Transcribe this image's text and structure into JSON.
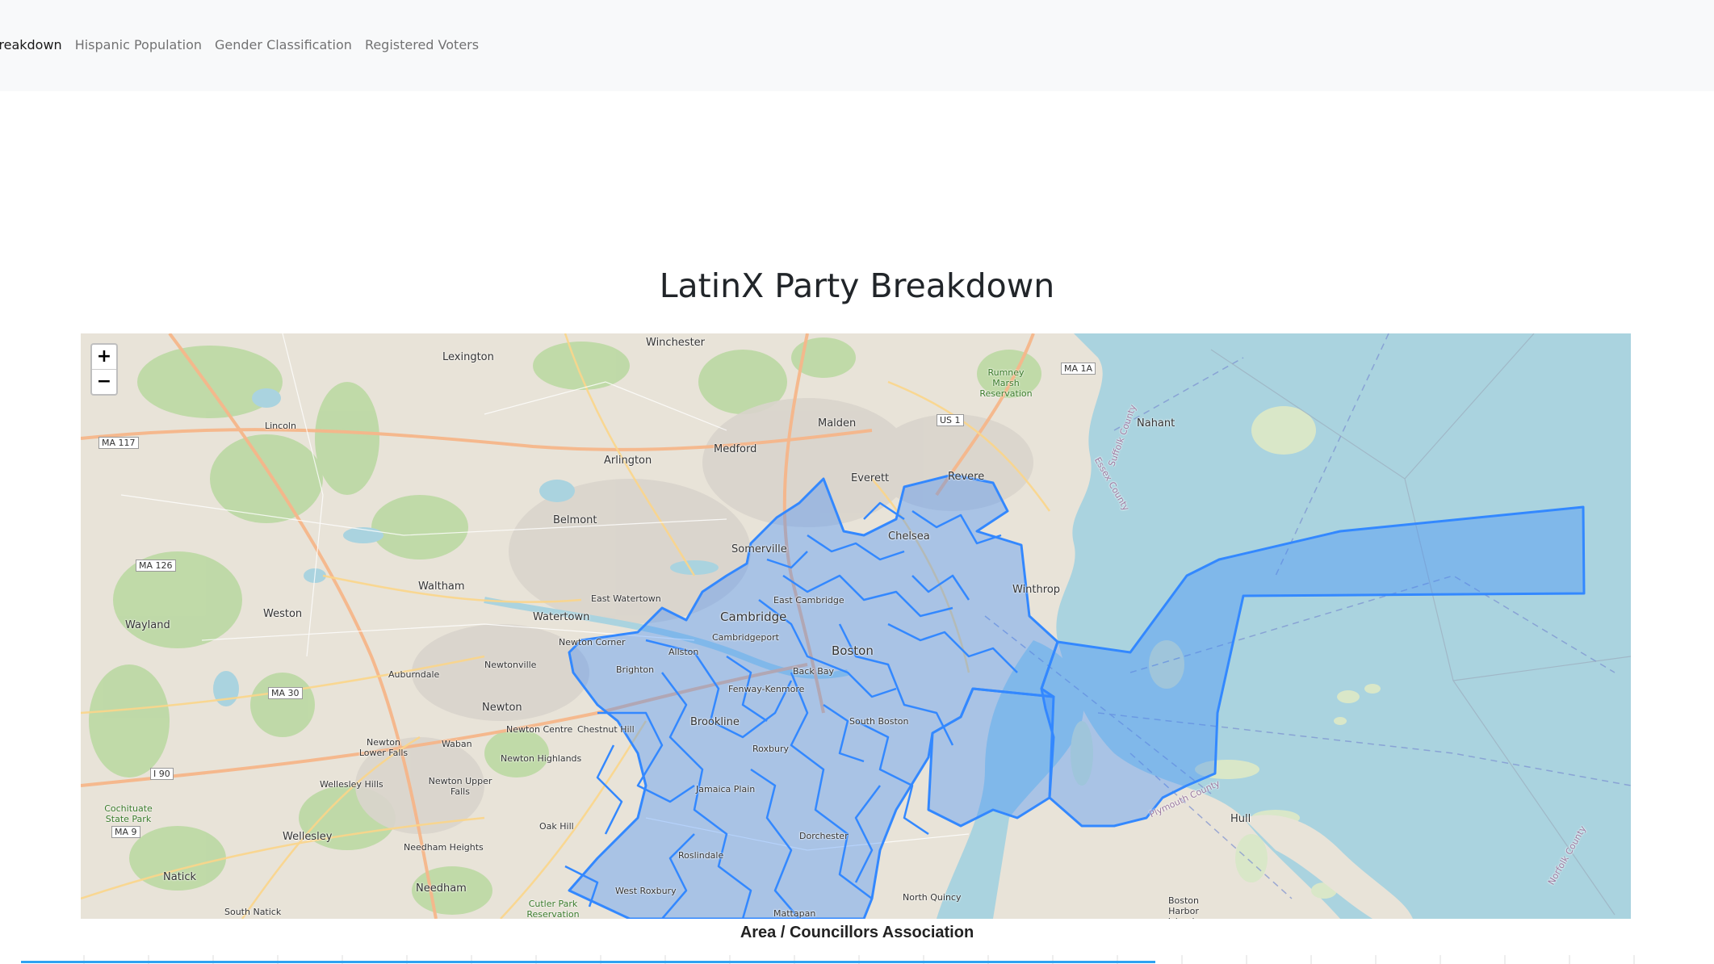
{
  "nav": {
    "items": [
      {
        "label": "rty Breakdown",
        "active": true
      },
      {
        "label": "Hispanic Population"
      },
      {
        "label": "Gender Classification"
      },
      {
        "label": "Registered Voters"
      }
    ]
  },
  "page": {
    "title": "LatinX Party Breakdown"
  },
  "map": {
    "zoom_in": "+",
    "zoom_out": "−",
    "region_color": "#3388ff",
    "water_color": "#aad3df",
    "labels": {
      "winchester": "Winchester",
      "lexington": "Lexington",
      "malden": "Malden",
      "medford": "Medford",
      "arlington": "Arlington",
      "everett": "Everett",
      "revere": "Revere",
      "nahant": "Nahant",
      "belmont": "Belmont",
      "somerville": "Somerville",
      "chelsea": "Chelsea",
      "lincoln": "Lincoln",
      "waltham": "Waltham",
      "east_watertown": "East Watertown",
      "east_cambridge": "East Cambridge",
      "winthrop": "Winthrop",
      "wayland": "Wayland",
      "weston": "Weston",
      "watertown": "Watertown",
      "cambridge": "Cambridge",
      "cambridgeport": "Cambridgeport",
      "newton_corner": "Newton Corner",
      "allston": "Allston",
      "brighton": "Brighton",
      "boston": "Boston",
      "auburndale": "Auburndale",
      "newtonville": "Newtonville",
      "back_bay": "Back Bay",
      "fenway": "Fenway-Kenmore",
      "newton": "Newton",
      "newton_centre": "Newton Centre",
      "chestnut_hill": "Chestnut Hill",
      "brookline": "Brookline",
      "south_boston": "South Boston",
      "newton_lower_falls": "Newton Lower Falls",
      "waban": "Waban",
      "newton_highlands": "Newton Highlands",
      "roxbury": "Roxbury",
      "wellesley_hills": "Wellesley Hills",
      "newton_upper_falls": "Newton Upper Falls",
      "jamaica_plain": "Jamaica Plain",
      "hull": "Hull",
      "wellesley": "Wellesley",
      "oak_hill": "Oak Hill",
      "dorchester": "Dorchester",
      "needham_heights": "Needham Heights",
      "roslindale": "Roslindale",
      "natick": "Natick",
      "needham": "Needham",
      "west_roxbury": "West Roxbury",
      "north_quincy": "North Quincy",
      "south_natick": "South Natick",
      "mattapan": "Mattapan",
      "ma117": "MA 117",
      "ma126": "MA 126",
      "ma30": "MA 30",
      "ma9": "MA 9",
      "i90": "I 90",
      "us1": "US 1",
      "ma1a": "MA 1A",
      "rumney": "Rumney Marsh Reservation",
      "cochituate": "Cochituate State Park",
      "cutler": "Cutler Park Reservation",
      "boston_harbor": "Boston Harbor Islands",
      "suffolk_county": "Suffolk County",
      "essex_county": "Essex County",
      "plymouth_county": "Plymouth County",
      "norfolk_county": "Norfolk County"
    }
  },
  "chart": {
    "title": "Area / Councillors Association"
  }
}
